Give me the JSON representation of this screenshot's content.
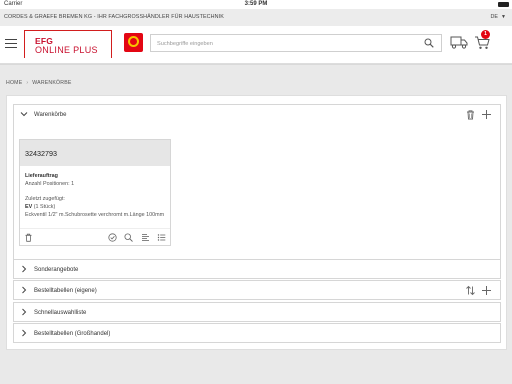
{
  "status_bar": {
    "carrier": "Carrier",
    "time": "3:59 PM"
  },
  "company_bar": {
    "name": "CORDES & GRAEFE BREMEN KG - IHR FACHGROSSHÄNDLER FÜR HAUSTECHNIK",
    "language": "DE"
  },
  "header": {
    "logo_line1": "EFG",
    "logo_line2": "ONLINE PLUS",
    "cg_logo_text": "CG GRUPPE",
    "search_placeholder": "Suchbegriffe eingeben",
    "cart_count": "1"
  },
  "breadcrumb": [
    "HOME",
    "WARENKÖRBE"
  ],
  "warenkoerbe": {
    "label": "Warenkörbe",
    "cart": {
      "number": "32432793",
      "type": "Lieferauftrag",
      "positions": "Anzahl Positionen: 1",
      "last_added_label": "Zuletzt zugefügt:",
      "last_added_code": "EV",
      "last_added_qty": "(1 Stück)",
      "last_added_desc": "Eckventil 1/2\" m.Schubrosette verchromt m.Länge 100mm"
    }
  },
  "sections": [
    {
      "label": "Sonderangebote"
    },
    {
      "label": "Bestelltabellen (eigene)"
    },
    {
      "label": "Schnellauswahlliste"
    },
    {
      "label": "Bestelltabellen (Großhandel)"
    }
  ],
  "colors": {
    "brand_red": "#c8102e",
    "badge_red": "#e30613",
    "cg_yellow": "#f6c400"
  }
}
